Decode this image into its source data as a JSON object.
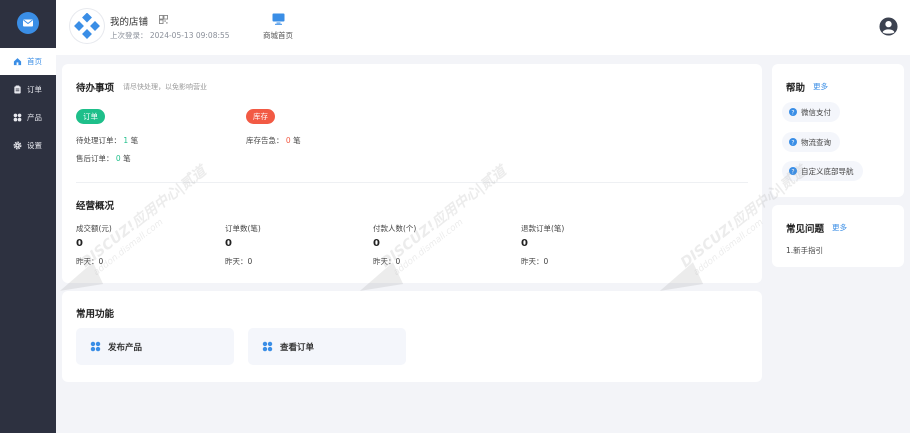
{
  "sidebar": {
    "items": [
      {
        "label": "首页",
        "icon": "home-icon",
        "active": true
      },
      {
        "label": "订单",
        "icon": "clipboard-icon",
        "active": false
      },
      {
        "label": "产品",
        "icon": "grid-icon",
        "active": false
      },
      {
        "label": "设置",
        "icon": "gear-icon",
        "active": false
      }
    ]
  },
  "header": {
    "shop_name": "我的店铺",
    "last_login_label": "上次登录：",
    "last_login_time": "2024-05-13 09:08:55",
    "store_home_label": "商城首页"
  },
  "todo": {
    "title": "待办事项",
    "hint": "请尽快处理，以免影响营业",
    "order_tag": "订单",
    "stock_tag": "库存",
    "pending_label": "待处理订单：",
    "pending_value": "1",
    "pending_unit": "笔",
    "aftersale_label": "售后订单：",
    "aftersale_value": "0",
    "aftersale_unit": "笔",
    "stock_label": "库存告急：",
    "stock_value": "0",
    "stock_unit": "笔"
  },
  "overview": {
    "title": "经营概况",
    "stats": [
      {
        "label": "成交额(元)",
        "value": "0",
        "yesterday_label": "昨天：",
        "yesterday": "0"
      },
      {
        "label": "订单数(笔)",
        "value": "0",
        "yesterday_label": "昨天：",
        "yesterday": "0"
      },
      {
        "label": "付款人数(个)",
        "value": "0",
        "yesterday_label": "昨天：",
        "yesterday": "0"
      },
      {
        "label": "退款订单(笔)",
        "value": "0",
        "yesterday_label": "昨天：",
        "yesterday": "0"
      }
    ]
  },
  "functions": {
    "title": "常用功能",
    "items": [
      {
        "label": "发布产品"
      },
      {
        "label": "查看订单"
      }
    ]
  },
  "help": {
    "title": "帮助",
    "more": "更多",
    "items": [
      {
        "label": "微信支付"
      },
      {
        "label": "物流查询"
      },
      {
        "label": "自定义底部导航"
      }
    ]
  },
  "faq": {
    "title": "常见问题",
    "more": "更多",
    "items": [
      {
        "label": "1.新手指引"
      }
    ]
  },
  "watermark": {
    "text": "DISCUZ!应用中心|贰道",
    "sub": "addon.dismall.com"
  },
  "colors": {
    "accent": "#3a8ee6",
    "sidebar_bg": "#2d3140",
    "green": "#1ebf8a",
    "red": "#f25a44"
  }
}
